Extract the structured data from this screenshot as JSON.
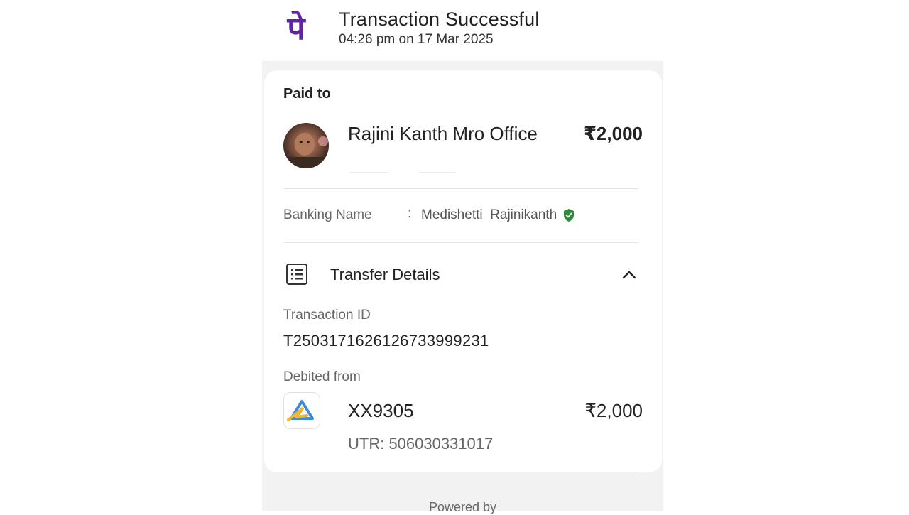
{
  "header": {
    "logo_text": "पे",
    "title": "Transaction Successful",
    "timestamp": "04:26 pm on 17 Mar 2025",
    "brand_color": "#5f259f"
  },
  "paid_to": {
    "label": "Paid to",
    "name": "Rajini Kanth Mro Office",
    "amount": "₹2,000"
  },
  "banking": {
    "label": "Banking Name",
    "separator": ":",
    "value": "Medishetti  Rajinikanth",
    "verified_color": "#2e8b3c"
  },
  "transfer_details": {
    "title": "Transfer Details",
    "transaction_id_label": "Transaction ID",
    "transaction_id": "T2503171626126733999231",
    "debited_from_label": "Debited from",
    "account": "XX9305",
    "amount": "₹2,000",
    "utr": "UTR: 506030331017"
  },
  "footer": {
    "powered_by": "Powered by"
  },
  "icons": [
    "phonepe-logo-icon",
    "avatar",
    "shield-check-icon",
    "receipt-list-icon",
    "chevron-up-icon",
    "bank-logo-icon"
  ]
}
